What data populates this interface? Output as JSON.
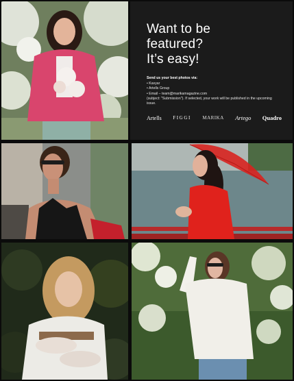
{
  "promo": {
    "headline": [
      "Want to be",
      "featured?",
      "It’s easy!"
    ],
    "lead": "Send us your best photos via:",
    "items": [
      "Kavyar",
      "Artells Group",
      "Email – team@marikamagazine.com"
    ],
    "note": "(subject: \"Submission\"). If selected, your work will be published in the upcoming issue.",
    "brands": [
      "Artells",
      "FIGGI",
      "MARIKA",
      "Artego",
      "Quadro"
    ]
  },
  "colors": {
    "background": "#0b0b0b",
    "panel": "#1b1b1b",
    "text": "#ffffff",
    "accent_red": "#d8231f",
    "accent_pink": "#d9456d"
  },
  "photos": [
    {
      "subject": "woman-pink-jacket-blossoms"
    },
    {
      "subject": "woman-sunglasses-black-sequin-top"
    },
    {
      "subject": "woman-red-dress-red-umbrella"
    },
    {
      "subject": "woman-white-blouse-dark-foliage"
    },
    {
      "subject": "woman-white-sweater-blossom-garden"
    }
  ]
}
